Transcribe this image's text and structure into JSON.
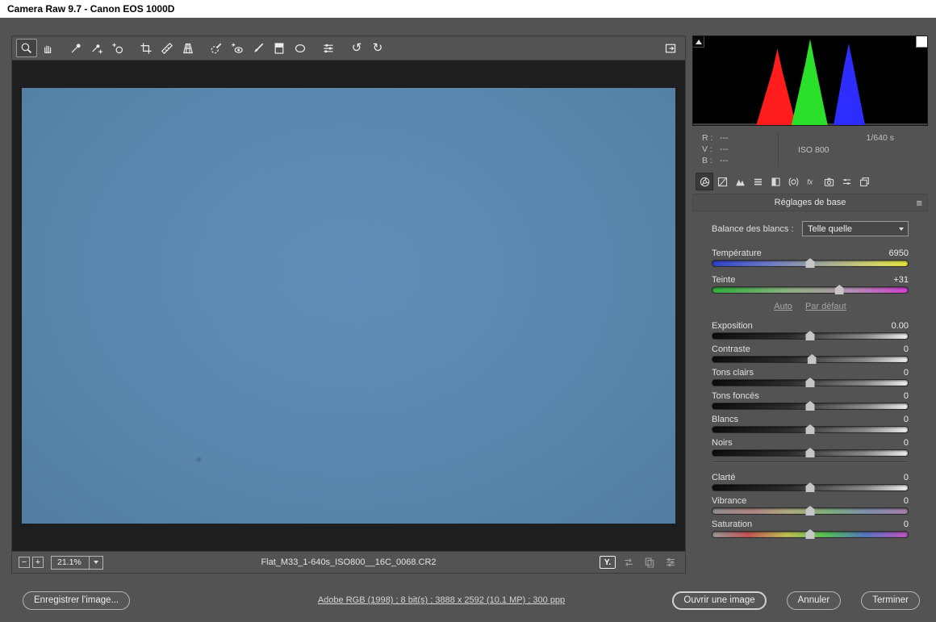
{
  "window": {
    "title": "Camera Raw 9.7 - Canon EOS 1000D"
  },
  "colors": {
    "panel_bg": "#535353",
    "canvas_bg": "#1e1e1e",
    "titlebar_bg": "#ffffff",
    "photo_blue": "#5f8db6",
    "photo_blue_edge": "#527da0"
  },
  "toolbar": {
    "tools": [
      "zoom",
      "hand",
      "white-balance",
      "color-sampler",
      "targeted-adjustment",
      "crop",
      "straighten",
      "transform",
      "spot-removal",
      "red-eye",
      "adjustment-brush",
      "graduated-filter",
      "radial-filter",
      "preferences",
      "rotate-left",
      "rotate-right",
      "toggle-fullscreen"
    ],
    "selected_tool": "zoom"
  },
  "histogram": {
    "peaks": [
      {
        "channel": "red",
        "color": "#ff1c1c",
        "left": 0.27,
        "apex": 0.36,
        "right": 0.44,
        "height": 0.86
      },
      {
        "channel": "green",
        "color": "#2ae02a",
        "left": 0.42,
        "apex": 0.5,
        "right": 0.575,
        "height": 0.97
      },
      {
        "channel": "blue",
        "color": "#2d2dff",
        "left": 0.6,
        "apex": 0.665,
        "right": 0.735,
        "height": 0.92
      }
    ]
  },
  "info": {
    "r_label": "R :",
    "r_value": "---",
    "v_label": "V :",
    "v_value": "---",
    "b_label": "B :",
    "b_value": "---",
    "shutter_speed": "1/640 s",
    "iso": "ISO 800"
  },
  "tabs": [
    "basic",
    "tone-curve",
    "detail",
    "hsl-grayscale",
    "split-toning",
    "lens-corrections",
    "effects",
    "camera-calibration",
    "presets",
    "snapshots"
  ],
  "selected_tab": "basic",
  "basic_panel": {
    "title": "Réglages de base",
    "menu_icon": "≡",
    "white_balance_label": "Balance des blancs :",
    "white_balance_value": "Telle quelle",
    "auto_link": "Auto",
    "default_link": "Par défaut",
    "wb_sliders": [
      {
        "name": "temperature",
        "label": "Température",
        "value": "6950",
        "track": "temp",
        "pos": 50
      },
      {
        "name": "tint",
        "label": "Teinte",
        "value": "+31",
        "track": "tint",
        "pos": 65
      }
    ],
    "tone_sliders": [
      {
        "name": "exposure",
        "label": "Exposition",
        "value": "0.00",
        "track": "gray",
        "pos": 50
      },
      {
        "name": "contrast",
        "label": "Contraste",
        "value": "0",
        "track": "gray",
        "pos": 51
      },
      {
        "name": "highlights",
        "label": "Tons clairs",
        "value": "0",
        "track": "gray",
        "pos": 50
      },
      {
        "name": "shadows",
        "label": "Tons foncés",
        "value": "0",
        "track": "gray",
        "pos": 50
      },
      {
        "name": "whites",
        "label": "Blancs",
        "value": "0",
        "track": "gray",
        "pos": 50
      },
      {
        "name": "blacks",
        "label": "Noirs",
        "value": "0",
        "track": "gray",
        "pos": 50
      }
    ],
    "presence_sliders": [
      {
        "name": "clarity",
        "label": "Clarté",
        "value": "0",
        "track": "gray",
        "pos": 50
      },
      {
        "name": "vibrance",
        "label": "Vibrance",
        "value": "0",
        "track": "rainbow-muted",
        "pos": 50
      },
      {
        "name": "saturation",
        "label": "Saturation",
        "value": "0",
        "track": "rainbow",
        "pos": 50
      }
    ]
  },
  "status_bar": {
    "zoom_out": "−",
    "zoom_in": "+",
    "zoom_level": "21.1%",
    "filename": "Flat_M33_1-640s_ISO800__16C_0068.CR2",
    "preview_label": "Y."
  },
  "footer": {
    "save_button": "Enregistrer l'image...",
    "workflow_link": "Adobe RGB (1998) ; 8 bit(s) ; 3888 x 2592 (10.1 MP) ; 300 ppp",
    "open_button": "Ouvrir une image",
    "cancel_button": "Annuler",
    "done_button": "Terminer"
  }
}
